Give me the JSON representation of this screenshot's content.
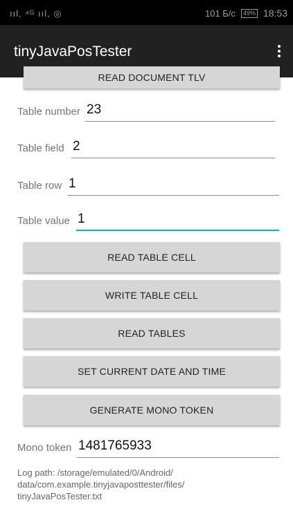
{
  "status_bar": {
    "signal": "ııl, ⁴ᴳ ııl, ◎",
    "speed": "101 Б/с",
    "battery": "49%",
    "time": "18:53"
  },
  "app_bar": {
    "title": "tinyJavaPosTester",
    "menu_icon": "more-vert-icon"
  },
  "buttons": {
    "read_document_tlv": "READ DOCUMENT TLV",
    "read_table_cell": "READ TABLE CELL",
    "write_table_cell": "WRITE TABLE CELL",
    "read_tables": "READ TABLES",
    "set_current_date_time": "SET CURRENT DATE AND TIME",
    "generate_mono_token": "GENERATE MONO TOKEN"
  },
  "fields": {
    "table_number": {
      "label": "Table number",
      "value": "23"
    },
    "table_field": {
      "label": "Table field",
      "value": "2"
    },
    "table_row": {
      "label": "Table row",
      "value": "1"
    },
    "table_value": {
      "label": "Table value",
      "value": "1"
    },
    "mono_token": {
      "label": "Mono token",
      "value": "1481765933"
    }
  },
  "log_path": {
    "line1": "Log path: /storage/emulated/0/Android/",
    "line2": "data/com.example.tinyjavaposttester/files/",
    "line3": "tinyJavaPosTester.txt"
  },
  "colors": {
    "accent": "#26a69a",
    "app_bar": "#212121",
    "button": "#d6d6d6"
  }
}
